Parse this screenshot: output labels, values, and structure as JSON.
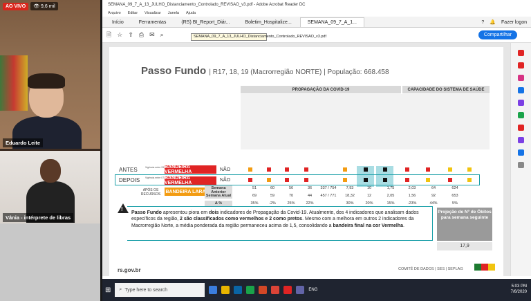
{
  "live": {
    "badge": "AO VIVO",
    "viewers": "9,6 mil"
  },
  "presenter": {
    "name": "Eduardo Leite"
  },
  "interpreter": {
    "name": "Vânia - intérprete de libras"
  },
  "window": {
    "title": "SEMANA_09_7_A_13_JULHO_Distanciamento_Controlado_REVISAO_v3.pdf - Adobe Acrobat Reader DC",
    "menu": [
      "Arquivo",
      "Editar",
      "Visualizar",
      "Janela",
      "Ajuda"
    ]
  },
  "tabs": {
    "home": "Início",
    "tools": "Ferramentas",
    "doc1": "(RS) BI_Report_Diár...",
    "doc2": "Boletim_Hospitalize...",
    "doc3": "SEMANA_09_7_A_1...",
    "help": "?",
    "login": "Fazer logon"
  },
  "toolbar": {
    "tooltip": "SEMANA_09_7_A_13_JULHO_Distanciamento_Controlado_REVISAO_v3.pdf",
    "share": "Compartilhar"
  },
  "page": {
    "title": "Passo Fundo",
    "subtitle": "| R17, 18, 19 (Macrorregião NORTE) | População: 668.458",
    "section_propagation": "PROPAGAÇÃO DA COVID-19",
    "section_capacity": "CAPACIDADE DO SISTEMA DE SAÚDE",
    "row_antes": "ANTES",
    "row_depois": "DEPOIS",
    "antes_band": "BANDEIRA VERMELHA",
    "depois_band": "BANDEIRA VERMELHA",
    "antes_nao": "NÃO",
    "depois_nao": "NÃO",
    "antes_vig": "Vigência entre 29.06 à 05.07",
    "depois_vig": "Vigência entre 07.07 à 13.07",
    "after_resources": "APÓS OS RECURSOS",
    "orange_band": "BANDEIRA LARANJA",
    "stats_labels": [
      "Semana Anterior",
      "Semana Atual",
      "Δ %"
    ],
    "stats_prev": [
      "51",
      "60",
      "56",
      "36",
      "337 / 754",
      "7,93",
      "10",
      "1,75",
      "2,03",
      "64",
      "624"
    ],
    "stats_curr": [
      "69",
      "59",
      "70",
      "44",
      "457 / 771",
      "18,32",
      "12",
      "2,05",
      "1,56",
      "92",
      "653"
    ],
    "stats_delta": [
      "35%",
      "-2%",
      "25%",
      "22%",
      "",
      "30%",
      "20%",
      "15%",
      "-23%",
      "44%",
      "5%"
    ],
    "notice": {
      "city": "Passo Fundo",
      "p1": " apresentou piora em ",
      "b1": "dois",
      "p2": " indicadores de Propagação da Covid-19. Atualmente, dos 4 indicadores que analisam dados específicos da região, ",
      "b2": "2 são classificados como vermelhos e 2 como pretos",
      "p3": ". Mesmo com a melhora em outros 2 indicadores da Macrorregião Norte, a média ponderada da região permaneceu acima de 1,5, consolidando a ",
      "b3": "bandeira final na cor Vermelha",
      "p4": "."
    },
    "projection_title": "Projeção de Nº de Óbitos para semana seguinte",
    "projection_value": "17,9",
    "footer_url": "rs.gov.br",
    "footer_right": "COMITÊ DE DADOS | SES | SEPLAG"
  },
  "taskbar": {
    "search_placeholder": "Type here to search",
    "lang": "ENG",
    "time": "5:03 PM",
    "date": "7/6/2020"
  },
  "colors": {
    "red": "#e02424",
    "orange": "#f39c12",
    "yellow": "#f1c40f",
    "black": "#111111",
    "teal": "#1a9fa8",
    "acrobat_blue": "#1473e6"
  }
}
